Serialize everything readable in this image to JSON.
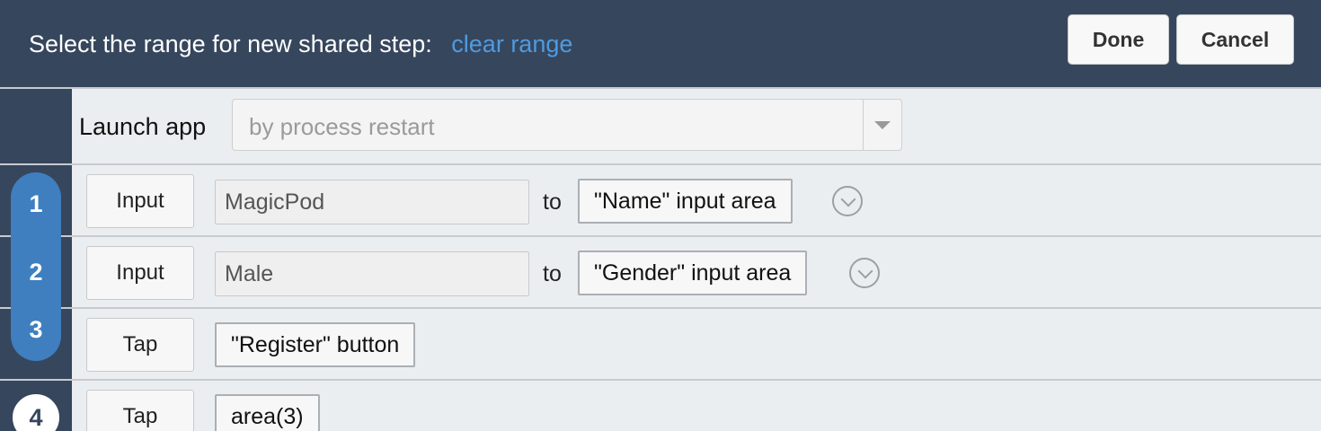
{
  "header": {
    "prompt": "Select the range for new shared step:",
    "clear_link": "clear range",
    "done_label": "Done",
    "cancel_label": "Cancel"
  },
  "launch": {
    "label": "Launch app",
    "select_value": "by process restart"
  },
  "steps": [
    {
      "number": "1",
      "action": "Input",
      "value": "MagicPod",
      "connector": "to",
      "target": "\"Name\" input area"
    },
    {
      "number": "2",
      "action": "Input",
      "value": "Male",
      "connector": "to",
      "target": "\"Gender\" input area"
    },
    {
      "number": "3",
      "action": "Tap",
      "target": "\"Register\" button"
    },
    {
      "number": "4",
      "action": "Tap",
      "target": "area(3)"
    }
  ],
  "icons": {
    "expand": "chevron-down-circle-icon",
    "dropdown": "caret-down-icon"
  },
  "colors": {
    "header_bg": "#36465d",
    "link": "#4f9be0",
    "range_pill": "#3f7fbf"
  }
}
